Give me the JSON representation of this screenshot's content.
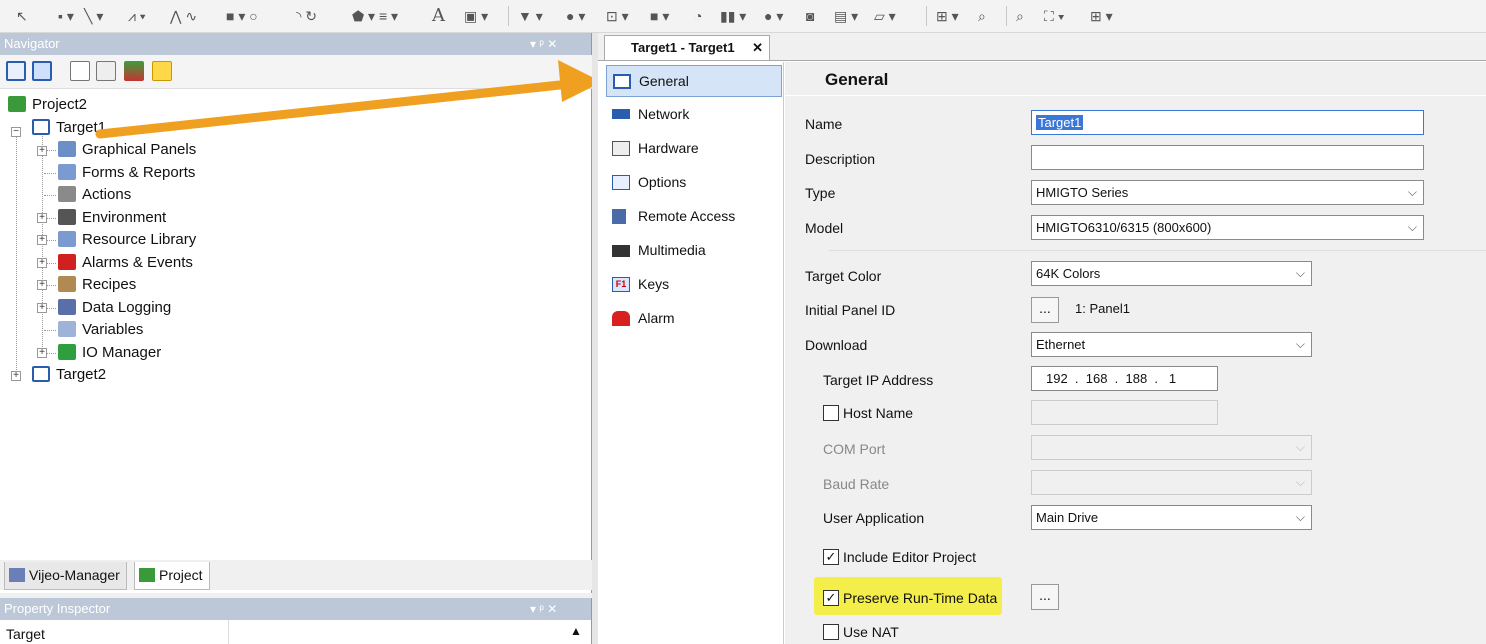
{
  "navigator": {
    "title": "Navigator",
    "pin": "▾ ᵖ ✕",
    "tree": {
      "project": "Project2",
      "target1": "Target1",
      "children": [
        "Graphical Panels",
        "Forms & Reports",
        "Actions",
        "Environment",
        "Resource Library",
        "Alarms & Events",
        "Recipes",
        "Data Logging",
        "Variables",
        "IO Manager"
      ],
      "target2": "Target2"
    },
    "tabs": [
      "Vijeo-Manager",
      "Project"
    ]
  },
  "property_inspector": {
    "title": "Property Inspector",
    "row_label": "Target"
  },
  "document_tab": {
    "label": "Target1 - Target1",
    "close": "✕"
  },
  "categories": [
    "General",
    "Network",
    "Hardware",
    "Options",
    "Remote Access",
    "Multimedia",
    "Keys",
    "Alarm"
  ],
  "general": {
    "heading": "General",
    "name_label": "Name",
    "name_value": "Target1",
    "description_label": "Description",
    "description_value": "",
    "type_label": "Type",
    "type_value": "HMIGTO Series",
    "model_label": "Model",
    "model_value": "HMIGTO6310/6315 (800x600)",
    "target_color_label": "Target Color",
    "target_color_value": "64K Colors",
    "initial_panel_label": "Initial Panel ID",
    "initial_panel_button": "...",
    "initial_panel_value": "1: Panel1",
    "download_label": "Download",
    "download_value": "Ethernet",
    "ip_label": "Target IP Address",
    "ip_value": "192  .  168  .  188  .   1",
    "host_name_label": "Host Name",
    "com_port_label": "COM Port",
    "baud_rate_label": "Baud Rate",
    "user_app_label": "User Application",
    "user_app_value": "Main Drive",
    "include_editor_label": "Include Editor Project",
    "preserve_label": "Preserve Run-Time Data",
    "preserve_button": "...",
    "use_nat_label": "Use NAT"
  },
  "colors": {
    "highlight": "#f3ee4a",
    "arrow": "#f0a020",
    "selection": "#3a77d6"
  }
}
